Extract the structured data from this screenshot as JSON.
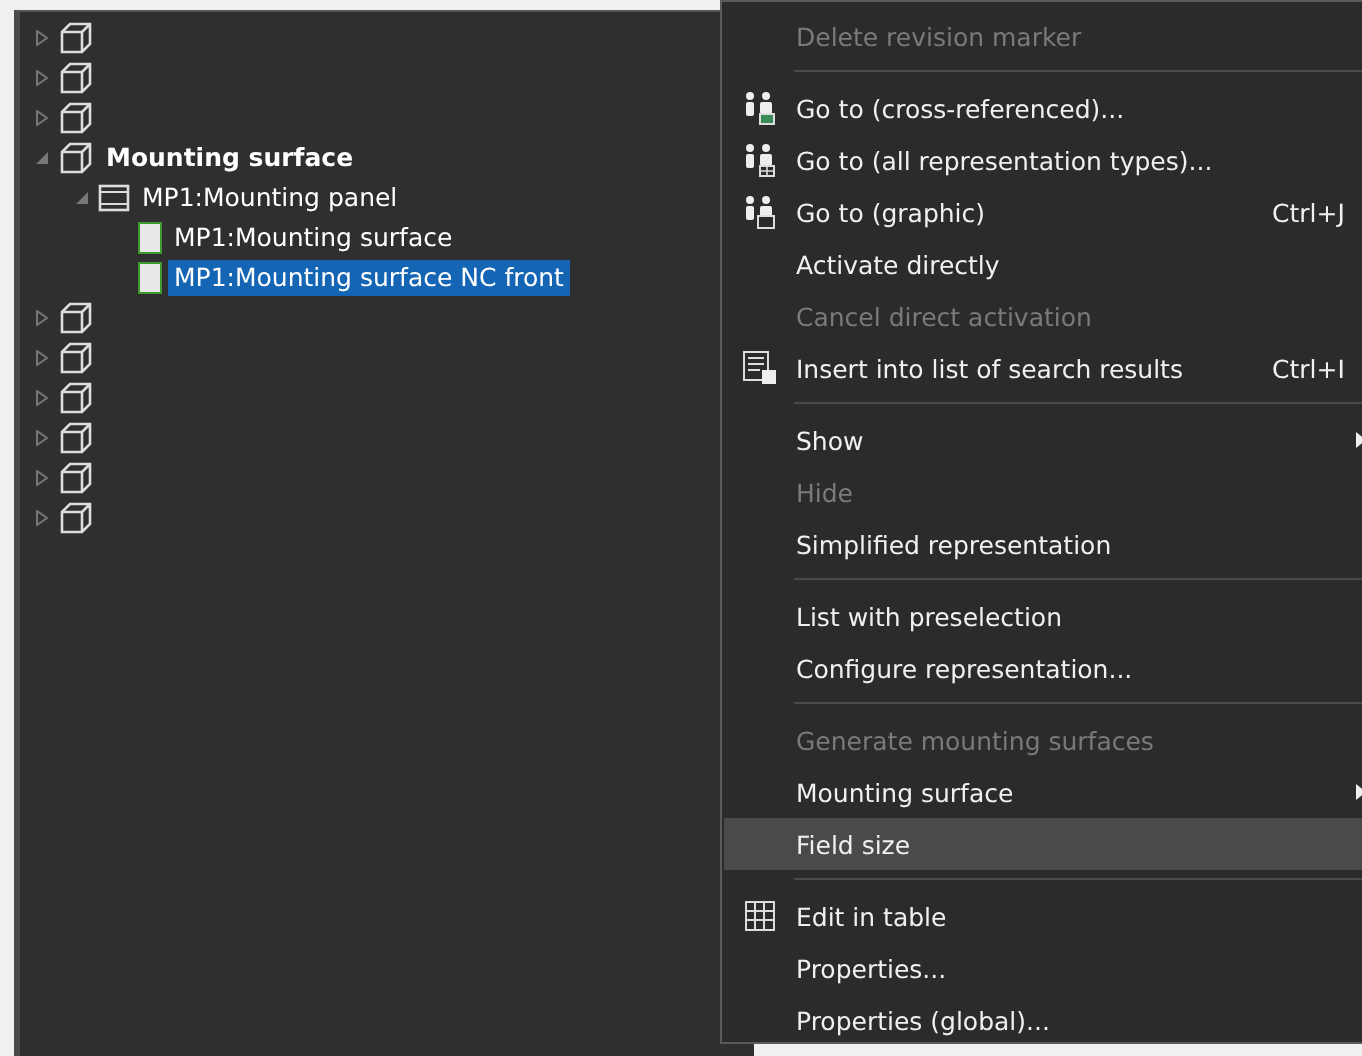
{
  "tree": [
    {
      "kind": "cube",
      "expanded": false,
      "selected": false
    },
    {
      "kind": "cube",
      "expanded": false,
      "selected": false
    },
    {
      "kind": "cube",
      "expanded": false,
      "selected": false
    },
    {
      "kind": "cube",
      "label": "Mounting surface",
      "expanded": true,
      "selected": false,
      "children": [
        {
          "kind": "panel",
          "label": "MP1:Mounting panel",
          "expanded": true,
          "selected": false,
          "children": [
            {
              "kind": "surface",
              "label": "MP1:Mounting surface",
              "selected": false
            },
            {
              "kind": "surface",
              "label": "MP1:Mounting surface NC front",
              "selected": true
            }
          ]
        }
      ]
    },
    {
      "kind": "cube",
      "expanded": false,
      "selected": false
    },
    {
      "kind": "cube",
      "expanded": false,
      "selected": false
    },
    {
      "kind": "cube",
      "expanded": false,
      "selected": false
    },
    {
      "kind": "cube",
      "expanded": false,
      "selected": false
    },
    {
      "kind": "cube",
      "expanded": false,
      "selected": false
    },
    {
      "kind": "cube",
      "expanded": false,
      "selected": false
    }
  ],
  "context_menu": [
    {
      "kind": "item",
      "label": "Delete revision marker",
      "disabled": true,
      "selected": false
    },
    {
      "kind": "separator"
    },
    {
      "kind": "crossref",
      "label": "Go to (cross-referenced)...",
      "disabled": false,
      "selected": false
    },
    {
      "kind": "alltypes",
      "label": "Go to (all representation types)...",
      "disabled": false,
      "selected": false
    },
    {
      "kind": "graphic",
      "label": "Go to (graphic)",
      "shortcut": "Ctrl+J",
      "disabled": false,
      "selected": false
    },
    {
      "kind": "item",
      "label": "Activate directly",
      "disabled": false,
      "selected": false
    },
    {
      "kind": "item",
      "label": "Cancel direct activation",
      "disabled": true,
      "selected": false
    },
    {
      "kind": "search",
      "label": "Insert into list of search results",
      "shortcut": "Ctrl+I",
      "disabled": false,
      "selected": false
    },
    {
      "kind": "separator"
    },
    {
      "kind": "item",
      "label": "Show",
      "submenu": true,
      "disabled": false,
      "selected": false
    },
    {
      "kind": "item",
      "label": "Hide",
      "disabled": true,
      "selected": false
    },
    {
      "kind": "item",
      "label": "Simplified representation",
      "disabled": false,
      "selected": false
    },
    {
      "kind": "separator"
    },
    {
      "kind": "item",
      "label": "List with preselection",
      "disabled": false,
      "selected": false
    },
    {
      "kind": "item",
      "label": "Configure representation...",
      "disabled": false,
      "selected": false
    },
    {
      "kind": "separator"
    },
    {
      "kind": "item",
      "label": "Generate mounting surfaces",
      "disabled": true,
      "selected": false
    },
    {
      "kind": "item",
      "label": "Mounting surface",
      "submenu": true,
      "disabled": false,
      "selected": false
    },
    {
      "kind": "item",
      "label": "Field size",
      "disabled": false,
      "selected": true
    },
    {
      "kind": "separator"
    },
    {
      "kind": "table",
      "label": "Edit in table",
      "disabled": false,
      "selected": false
    },
    {
      "kind": "item",
      "label": "Properties...",
      "disabled": false,
      "selected": false
    },
    {
      "kind": "item",
      "label": "Properties (global)...",
      "disabled": false,
      "selected": false
    }
  ]
}
